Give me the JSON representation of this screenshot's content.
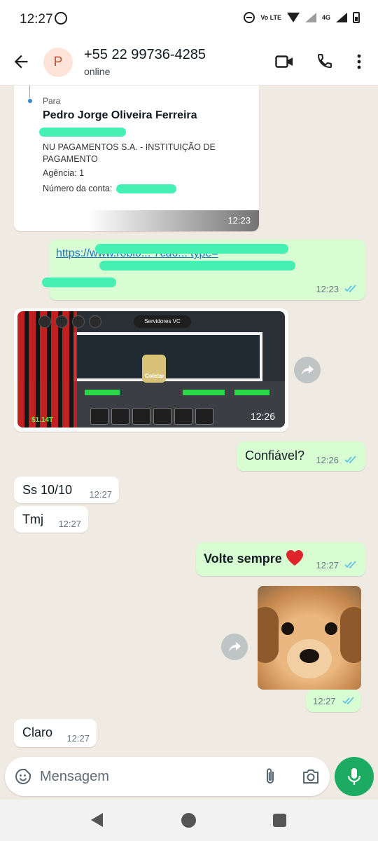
{
  "status_bar": {
    "time": "12:27",
    "network_label": "4G",
    "volte_label": "Vo LTE"
  },
  "header": {
    "avatar_letter": "P",
    "contact_name": "+55 22 99736-4285",
    "contact_status": "online"
  },
  "messages": [
    {
      "type": "image-receipt",
      "direction": "in",
      "time": "12:23",
      "to_label": "Para",
      "recipient": "Pedro Jorge Oliveira Ferreira",
      "bank": "NU PAGAMENTOS S.A. - INSTITUIÇÃO DE PAGAMENTO",
      "agency": "Agência: 1",
      "account_label": "Número da conta:"
    },
    {
      "type": "link",
      "direction": "out",
      "time": "12:23",
      "text": "https://www.roblo... 7cd6... type=",
      "read": true
    },
    {
      "type": "image",
      "direction": "in",
      "time": "12:26",
      "game_server_label": "Servidores VC",
      "game_money": "$1.14T",
      "game_action": "Coletar"
    },
    {
      "type": "text",
      "direction": "out",
      "time": "12:26",
      "text": "Confiável?",
      "read": true
    },
    {
      "type": "text",
      "direction": "in",
      "time": "12:27",
      "text": "Ss 10/10"
    },
    {
      "type": "text",
      "direction": "in",
      "time": "12:27",
      "text": "Tmj"
    },
    {
      "type": "text",
      "direction": "out",
      "time": "12:27",
      "text": "Volte sempre",
      "read": true
    },
    {
      "type": "sticker",
      "direction": "out",
      "time": "12:27",
      "read": true
    },
    {
      "type": "text",
      "direction": "in",
      "time": "12:27",
      "text": "Claro"
    }
  ],
  "composer": {
    "placeholder": "Mensagem"
  },
  "colors": {
    "outgoing_bubble": "#d9fdd3",
    "incoming_bubble": "#ffffff",
    "background": "#efeae2",
    "accent": "#1daa61",
    "read_ticks": "#53bdeb"
  }
}
